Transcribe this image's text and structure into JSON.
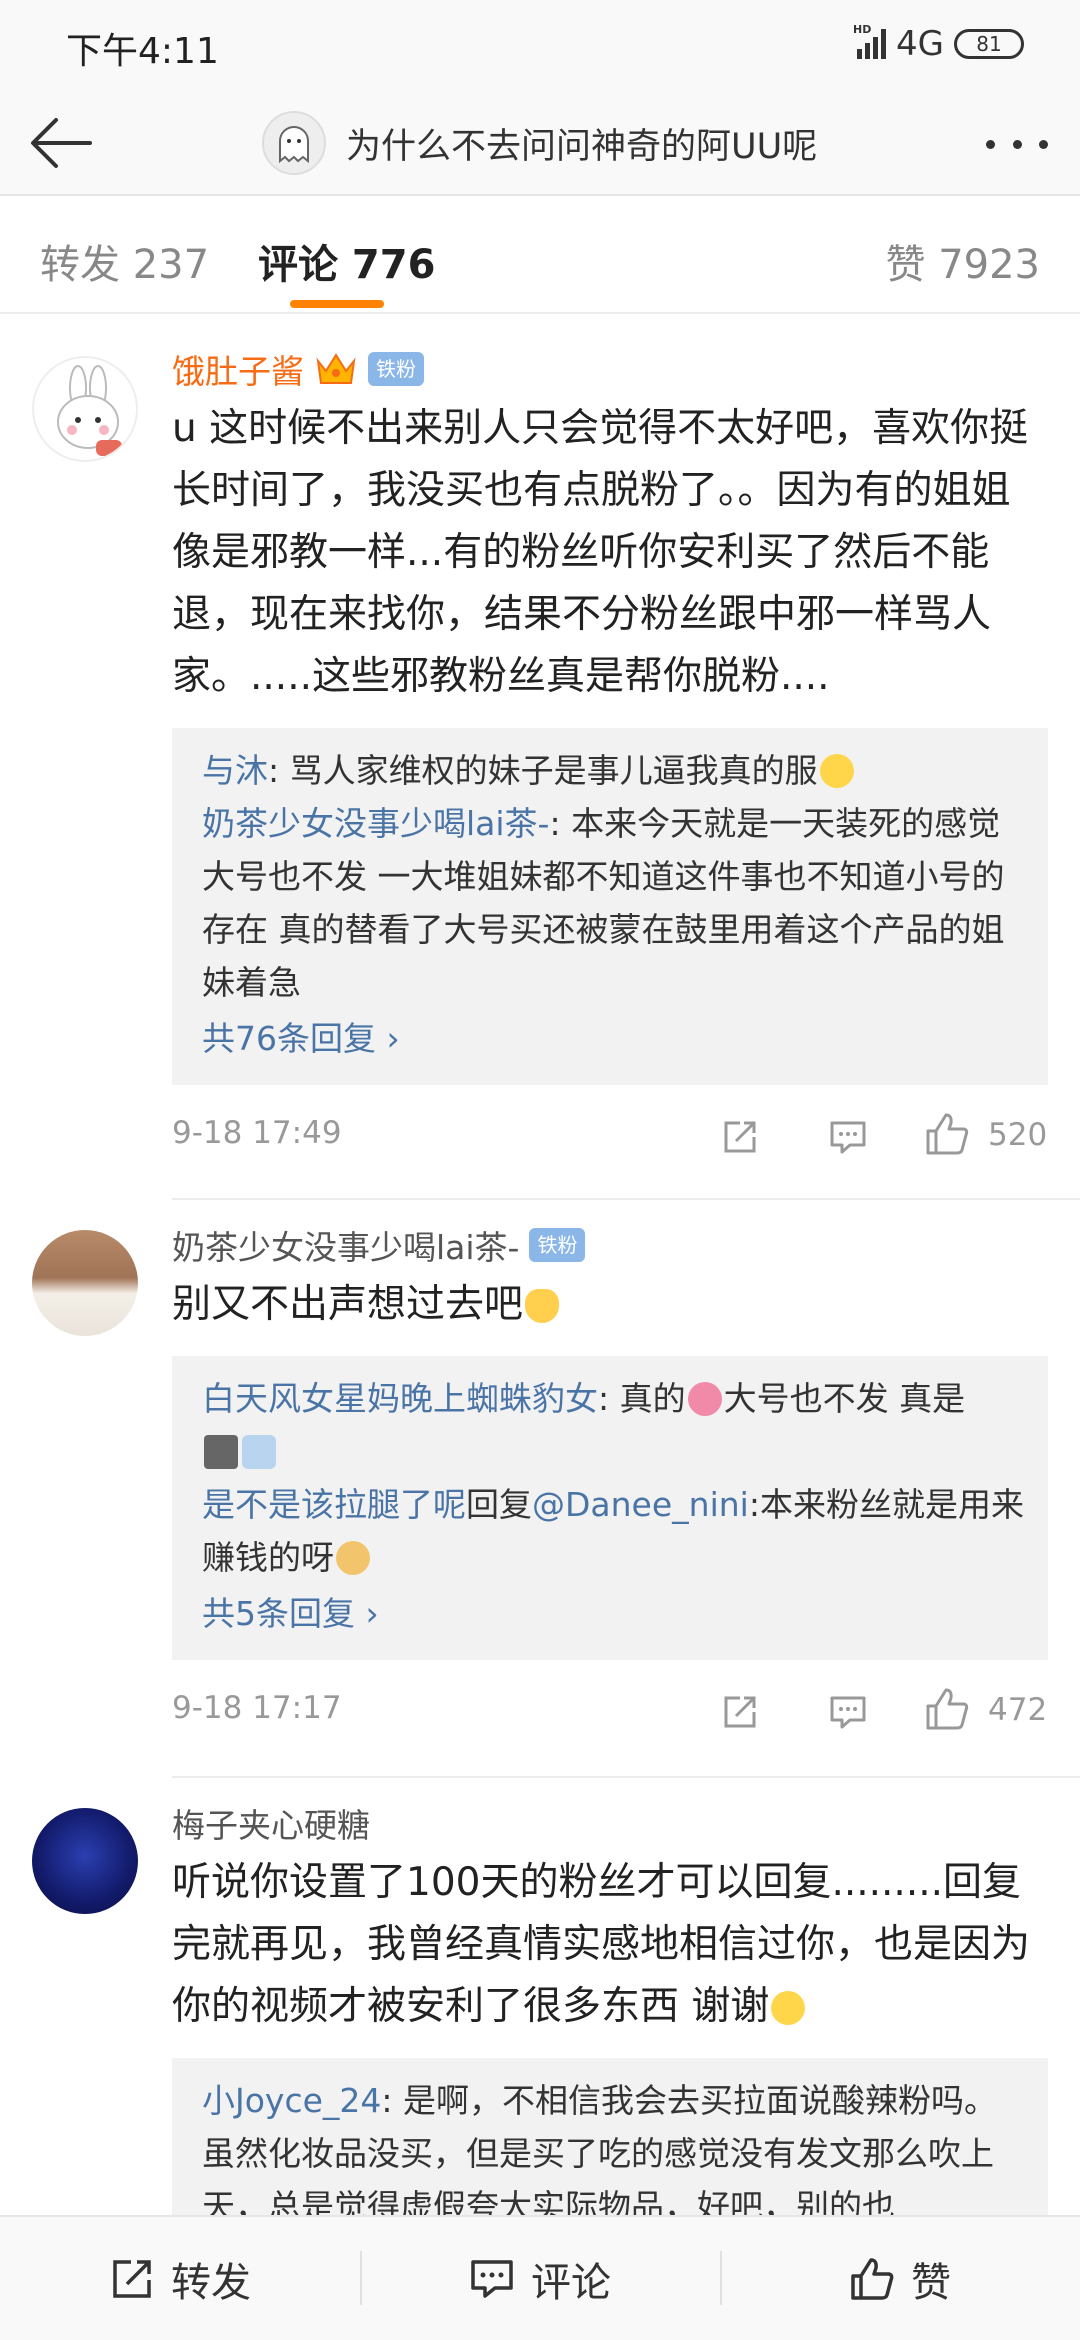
{
  "status_bar": {
    "time": "下午4:11",
    "network": "4G",
    "battery": "81"
  },
  "nav": {
    "title": "为什么不去问问神奇的阿UU呢"
  },
  "tabs": {
    "repost": "转发 237",
    "comment": "评论 776",
    "like": "赞 7923"
  },
  "comments": [
    {
      "user": "饿肚子酱",
      "badge": "铁粉",
      "text": "u 这时候不出来别人只会觉得不太好吧，喜欢你挺长时间了，我没买也有点脱粉了。。因为有的姐姐像是邪教一样...有的粉丝听你安利买了然后不能退，现在来找你，结果不分粉丝跟中邪一样骂人家。.....这些邪教粉丝真是帮你脱粉....",
      "replies": [
        {
          "user": "与沐",
          "text": ": 骂人家维权的妹子是事儿逼我真的服"
        },
        {
          "user": "奶茶少女没事少喝lai茶-",
          "text": ": 本来今天就是一天装死的感觉  大号也不发  一大堆姐妹都不知道这件事也不知道小号的存在  真的替看了大号买还被蒙在鼓里用着这个产品的姐妹着急"
        }
      ],
      "more": "共76条回复 ›",
      "time": "9-18 17:49",
      "likes": "520"
    },
    {
      "user": "奶茶少女没事少喝lai茶-",
      "badge": "铁粉",
      "text": "别又不出声想过去吧",
      "replies": [
        {
          "user": "白天风女星妈晚上蜘蛛豹女",
          "text": ": 真的",
          "text2": "大号也不发 真是"
        },
        {
          "user": "是不是该拉腿了呢",
          "mid": "回复",
          "mention": "@Danee_nini",
          "text": ":本来粉丝就是用来赚钱的呀"
        }
      ],
      "more": "共5条回复 ›",
      "time": "9-18 17:17",
      "likes": "472"
    },
    {
      "user": "梅子夹心硬糖",
      "text": "听说你设置了100天的粉丝才可以回复.........回复完就再见，我曾经真情实感地相信过你，也是因为你的视频才被安利了很多东西 谢谢",
      "replies": [
        {
          "user": "小Joyce_24",
          "text": ": 是啊，不相信我会去买拉面说酸辣粉吗。虽然化妆品没买，但是买了吃的感觉没有发文那么吹上天，总是觉得虚假夸大实际物品，好吧，别的也"
        }
      ]
    }
  ],
  "bottom_bar": {
    "repost": "转发",
    "comment": "评论",
    "like": "赞"
  }
}
